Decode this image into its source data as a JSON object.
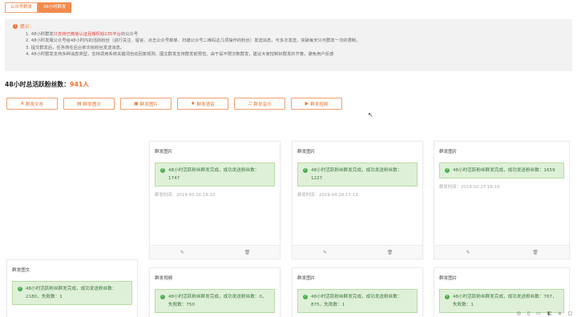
{
  "tabs": [
    {
      "label": "公众号群发"
    },
    {
      "label": "48小时群发"
    }
  ],
  "tips": {
    "head": "提示：",
    "line1_pre": "1. 48小时群发",
    "line1_red": "只支持已微信认证且授权给135平台",
    "line1_post": "的公众号",
    "line2": "2. 48小时发服公众号给48小时内的活跃粉丝（进行关注、留言、点击公众号菜单、扫描公众号二维码这几项操作的粉丝）发送消息，可多次发送，突破每天只可群发一次的限制。",
    "line3": "3. 提交群发后，任务将在后台依次给粉丝发送消息。",
    "line4": "4. 48小时群发支持多种消息类型，支持调用系统关键词自动回复规则、图文群发支持群发前预览。由于是不限次数群发，建议大家控制好群发的节奏，避免用户反感"
  },
  "fans": {
    "label": "48小时总活跃粉丝数：",
    "count": "941人"
  },
  "actions": [
    {
      "icon": "A",
      "label": "群发文本"
    },
    {
      "icon": "▤",
      "label": "群发图文"
    },
    {
      "icon": "▣",
      "label": "群发图片"
    },
    {
      "icon": "♦",
      "label": "群发语音"
    },
    {
      "icon": "♫",
      "label": "群发音乐"
    },
    {
      "icon": "▶",
      "label": "群发视频"
    }
  ],
  "cards": [
    {
      "title": "群发图片",
      "msg": "48小时活跃粉丝群发完成，成功发送粉丝数：1747",
      "time": "群发时间：2019-05-16 18:10"
    },
    {
      "title": "群发图片",
      "msg": "48小时活跃粉丝群发完成，成功发送粉丝数：1227",
      "time": "群发时间：2019-04-28 17:13"
    },
    {
      "title": "群发图片",
      "msg": "48小时活跃粉丝群发完成，成功发送粉丝数：1659",
      "time": "群发时间：2019-02-27 16:18"
    },
    {
      "title": "群发图文",
      "msg": "48小时活跃粉丝群发完成，成功发送粉丝数：2180，失败数：1"
    },
    {
      "title": "群发视频",
      "msg": "48小时活跃粉丝群发完成，成功发送粉丝数：0，失败数：750"
    },
    {
      "title": "群发图片",
      "msg": "48小时活跃粉丝群发完成，成功发送粉丝数：875，失败数：1"
    },
    {
      "title": "群发图片",
      "msg": "48小时活跃粉丝群发完成，成功发送粉丝数：767，失败数：1"
    }
  ],
  "footer_icons": [
    "edit-icon",
    "trash-icon"
  ],
  "corner_icons": [
    "◎",
    "▯",
    "▭",
    "◧",
    "⌂",
    "▢"
  ]
}
